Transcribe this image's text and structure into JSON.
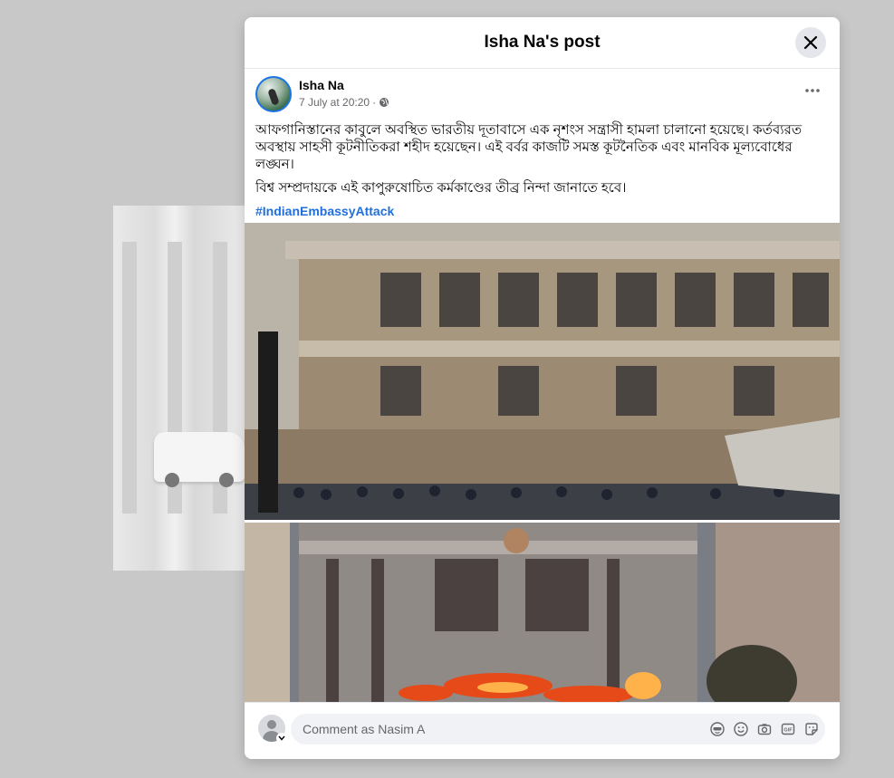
{
  "modal": {
    "title": "Isha Na's post"
  },
  "post": {
    "author": "Isha Na",
    "timestamp": "7 July at 20:20",
    "audience_separator": "·",
    "paragraphs": [
      "আফগানিস্তানের কাবুলে অবস্থিত ভারতীয় দূতাবাসে এক নৃশংস সন্ত্রাসী হামলা চালানো হয়েছে। কর্তব্যরত অবস্থায় সাহসী কূটনীতিকরা শহীদ হয়েছেন। এই বর্বর কাজটি সমস্ত কূটনৈতিক এবং মানবিক মূল্যবোধের লঙ্ঘন।",
      "বিশ্ব সম্প্রদায়কে এই কাপুরুষোচিত কর্মকাণ্ডের তীব্র নিন্দা জানাতে হবে।"
    ],
    "hashtag": "#IndianEmbassyAttack"
  },
  "comment": {
    "placeholder": "Comment as Nasim A"
  },
  "icons": {
    "close": "close-icon",
    "more": "more-options-icon",
    "globe": "globe-icon",
    "avatar_sticker": "avatar-sticker-icon",
    "emoji": "emoji-icon",
    "camera": "camera-icon",
    "gif": "gif-icon",
    "sticker": "sticker-icon"
  },
  "colors": {
    "accent": "#1b74e4",
    "hashtag": "#216fdb",
    "muted": "#65676b",
    "background": "#c8c8c8"
  }
}
